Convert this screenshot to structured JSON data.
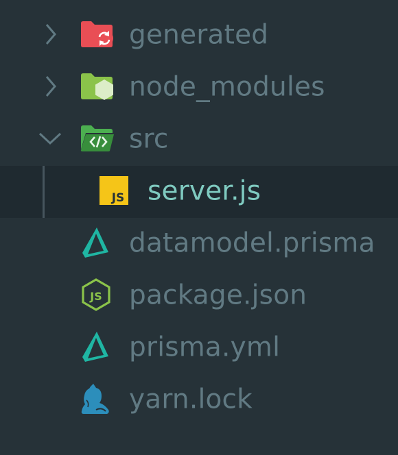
{
  "explorer": {
    "items": [
      {
        "label": "generated",
        "type": "folder",
        "expanded": false,
        "icon": "folder-generated-icon"
      },
      {
        "label": "node_modules",
        "type": "folder",
        "expanded": false,
        "icon": "folder-node-icon"
      },
      {
        "label": "src",
        "type": "folder",
        "expanded": true,
        "icon": "folder-src-icon"
      },
      {
        "label": "server.js",
        "type": "file",
        "selected": true,
        "icon": "javascript-file-icon"
      },
      {
        "label": "datamodel.prisma",
        "type": "file",
        "icon": "prisma-icon"
      },
      {
        "label": "package.json",
        "type": "file",
        "icon": "nodejs-icon"
      },
      {
        "label": "prisma.yml",
        "type": "file",
        "icon": "prisma-icon"
      },
      {
        "label": "yarn.lock",
        "type": "file",
        "icon": "yarn-icon"
      }
    ],
    "js_badge_text": "JS",
    "colors": {
      "background": "#263238",
      "selected_background": "#1f2a30",
      "label": "#617a83",
      "selected_label": "#7fcac0",
      "generated_folder": "#e94e55",
      "node_folder": "#8bc34a",
      "src_folder": "#4caf50",
      "js_badge": "#f5c518",
      "prisma": "#1fb6a3",
      "nodejs": "#8bc34a",
      "yarn": "#2c8ebb"
    }
  }
}
